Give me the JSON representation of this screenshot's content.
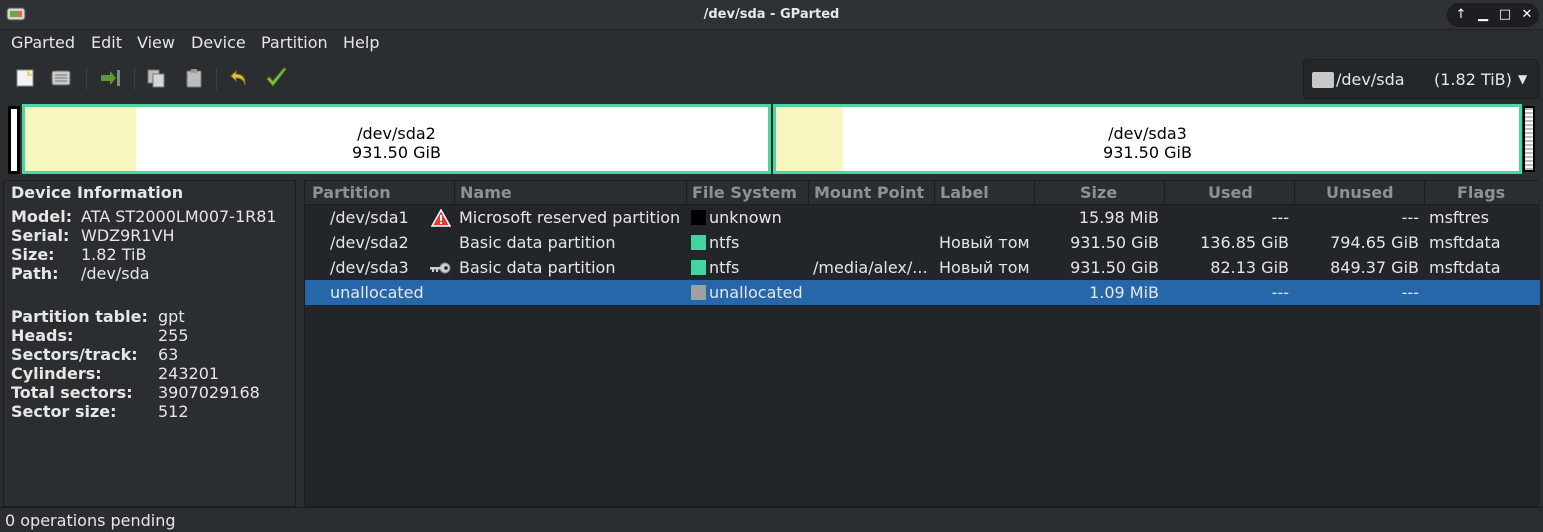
{
  "window": {
    "title": "/dev/sda - GParted"
  },
  "menu": [
    "GParted",
    "Edit",
    "View",
    "Device",
    "Partition",
    "Help"
  ],
  "toolbar": {
    "buttons": [
      "new-icon",
      "delete-icon",
      "resize-move-icon",
      "copy-icon",
      "paste-icon",
      "undo-icon",
      "apply-icon"
    ],
    "device": "/dev/sda",
    "device_size": "(1.82 TiB)"
  },
  "disk_map": [
    {
      "name": "/dev/sda2",
      "size": "931.50 GiB",
      "used_fraction": 0.15
    },
    {
      "name": "/dev/sda3",
      "size": "931.50 GiB",
      "used_fraction": 0.09
    }
  ],
  "device_info": {
    "heading": "Device Information",
    "rows": [
      {
        "key": "Model:",
        "value": "ATA ST2000LM007-1R81"
      },
      {
        "key": "Serial:",
        "value": "WDZ9R1VH"
      },
      {
        "key": "Size:",
        "value": "1.82 TiB"
      },
      {
        "key": "Path:",
        "value": "/dev/sda"
      }
    ],
    "rows2": [
      {
        "key": "Partition table:",
        "value": "gpt"
      },
      {
        "key": "Heads:",
        "value": "255"
      },
      {
        "key": "Sectors/track:",
        "value": "63"
      },
      {
        "key": "Cylinders:",
        "value": "243201"
      },
      {
        "key": "Total sectors:",
        "value": "3907029168"
      },
      {
        "key": "Sector size:",
        "value": "512"
      }
    ]
  },
  "table": {
    "columns": [
      "Partition",
      "Name",
      "File System",
      "Mount Point",
      "Label",
      "Size",
      "Used",
      "Unused",
      "Flags"
    ],
    "rows": [
      {
        "partition": "/dev/sda1",
        "icon": "warning-icon",
        "name": "Microsoft reserved partition",
        "fs": "unknown",
        "fs_color": "#000000",
        "mount": "",
        "label": "",
        "size": "15.98 MiB",
        "used": "---",
        "unused": "---",
        "flags": "msftres",
        "selected": false
      },
      {
        "partition": "/dev/sda2",
        "icon": "",
        "name": "Basic data partition",
        "fs": "ntfs",
        "fs_color": "#42d5a0",
        "mount": "",
        "label": "Новый том",
        "size": "931.50 GiB",
        "used": "136.85 GiB",
        "unused": "794.65 GiB",
        "flags": "msftdata",
        "selected": false
      },
      {
        "partition": "/dev/sda3",
        "icon": "key-icon",
        "name": "Basic data partition",
        "fs": "ntfs",
        "fs_color": "#42d5a0",
        "mount": "/media/alex/...",
        "label": "Новый том",
        "size": "931.50 GiB",
        "used": "82.13 GiB",
        "unused": "849.37 GiB",
        "flags": "msftdata",
        "selected": false
      },
      {
        "partition": "unallocated",
        "icon": "",
        "name": "",
        "fs": "unallocated",
        "fs_color": "#a0a0a0",
        "mount": "",
        "label": "",
        "size": "1.09 MiB",
        "used": "---",
        "unused": "---",
        "flags": "",
        "selected": true
      }
    ]
  },
  "status": "0 operations pending"
}
